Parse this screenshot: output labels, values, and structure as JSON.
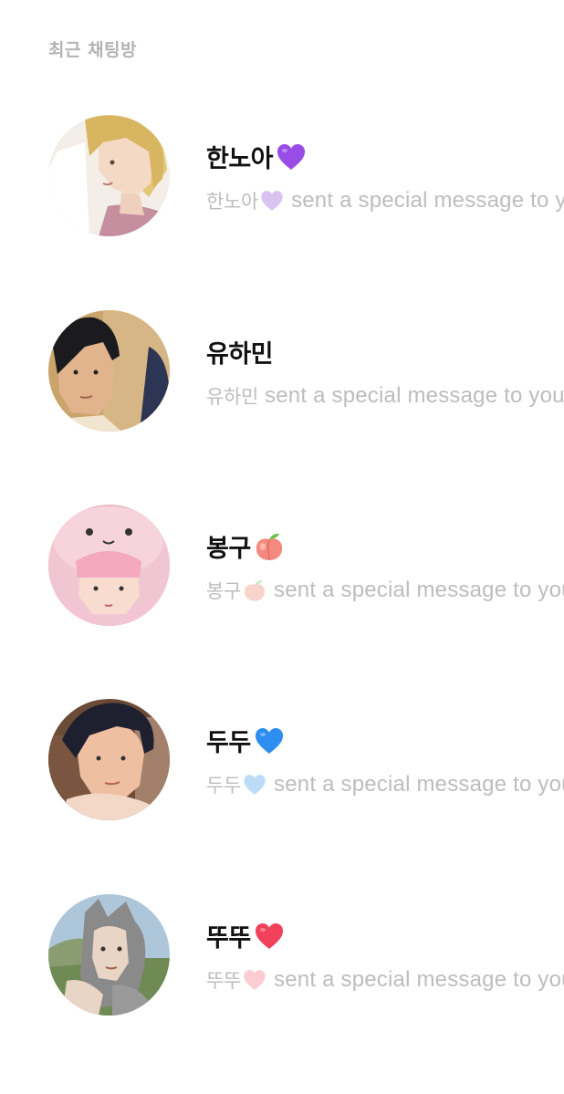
{
  "section": {
    "title": "최근 채팅방"
  },
  "chats": [
    {
      "name": "한노아",
      "preview_name": "한노아",
      "preview_text": "sent a special message to you",
      "emoji": "purple-heart",
      "emoji_color": "#9a4de6",
      "emoji_light_color": "#d9c3f3"
    },
    {
      "name": "유하민",
      "preview_name": "유하민",
      "preview_text": "sent a special message to you",
      "emoji": "",
      "emoji_color": "",
      "emoji_light_color": ""
    },
    {
      "name": "봉구",
      "preview_name": "봉구",
      "preview_text": "sent a special message to you",
      "emoji": "peach",
      "emoji_color": "#f48a7e",
      "emoji_light_color": "#f9d4cc"
    },
    {
      "name": "두두",
      "preview_name": "두두",
      "preview_text": "sent a special message to you",
      "emoji": "blue-heart",
      "emoji_color": "#2d8ef0",
      "emoji_light_color": "#bcdcf7"
    },
    {
      "name": "뚜뚜",
      "preview_name": "뚜뚜",
      "preview_text": "sent a special message to you",
      "emoji": "red-heart",
      "emoji_color": "#f0405a",
      "emoji_light_color": "#fbcdd3"
    }
  ]
}
